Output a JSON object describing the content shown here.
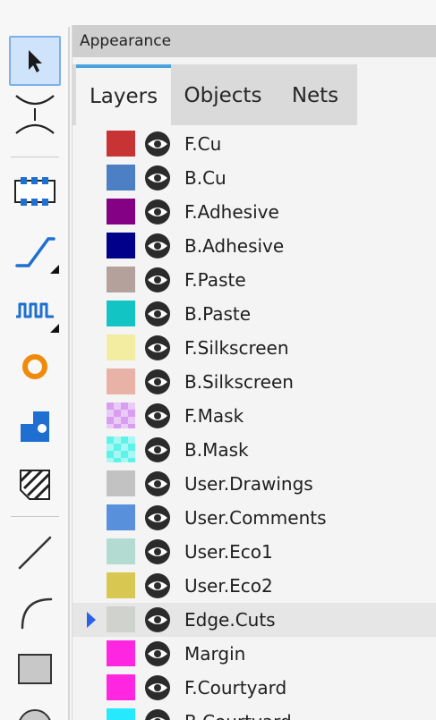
{
  "panel": {
    "title": "Appearance"
  },
  "tabs": [
    {
      "label": "Layers",
      "active": true
    },
    {
      "label": "Objects",
      "active": false
    },
    {
      "label": "Nets",
      "active": false
    }
  ],
  "toolbar": {
    "tools": [
      {
        "icon": "select-arrow-icon",
        "active": true
      },
      {
        "icon": "local-ratsnest-icon",
        "active": false
      },
      {
        "icon": "add-footprint-icon",
        "active": false
      },
      {
        "icon": "route-track-icon",
        "active": false
      },
      {
        "icon": "tune-length-icon",
        "active": false
      },
      {
        "icon": "add-via-icon",
        "active": false
      },
      {
        "icon": "add-pad-icon",
        "active": false
      },
      {
        "icon": "add-zone-icon",
        "active": false
      },
      {
        "icon": "draw-line-icon",
        "active": false
      },
      {
        "icon": "draw-arc-icon",
        "active": false
      },
      {
        "icon": "draw-rectangle-icon",
        "active": false
      },
      {
        "icon": "draw-circle-icon",
        "active": false
      }
    ]
  },
  "layers": [
    {
      "name": "F.Cu",
      "color": "#c83434",
      "pattern": "solid",
      "selected": false
    },
    {
      "name": "B.Cu",
      "color": "#4d7fc4",
      "pattern": "solid",
      "selected": false
    },
    {
      "name": "F.Adhesive",
      "color": "#840084",
      "pattern": "solid",
      "selected": false
    },
    {
      "name": "B.Adhesive",
      "color": "#00008a",
      "pattern": "solid",
      "selected": false
    },
    {
      "name": "F.Paste",
      "color": "#b4a19b",
      "pattern": "solid",
      "selected": false
    },
    {
      "name": "B.Paste",
      "color": "#13c4c4",
      "pattern": "solid",
      "selected": false
    },
    {
      "name": "F.Silkscreen",
      "color": "#f2eda1",
      "pattern": "solid",
      "selected": false
    },
    {
      "name": "B.Silkscreen",
      "color": "#e8b2a7",
      "pattern": "solid",
      "selected": false
    },
    {
      "name": "F.Mask",
      "color": "#d89ef0",
      "pattern": "checker",
      "selected": false
    },
    {
      "name": "B.Mask",
      "color": "#5ef3e8",
      "pattern": "checker",
      "selected": false
    },
    {
      "name": "User.Drawings",
      "color": "#c2c2c2",
      "pattern": "solid",
      "selected": false
    },
    {
      "name": "User.Comments",
      "color": "#5990dc",
      "pattern": "solid",
      "selected": false
    },
    {
      "name": "User.Eco1",
      "color": "#b4dbd2",
      "pattern": "solid",
      "selected": false
    },
    {
      "name": "User.Eco2",
      "color": "#d8c852",
      "pattern": "solid",
      "selected": false
    },
    {
      "name": "Edge.Cuts",
      "color": "#d0d2cd",
      "pattern": "solid",
      "selected": true
    },
    {
      "name": "Margin",
      "color": "#ff26e2",
      "pattern": "solid",
      "selected": false
    },
    {
      "name": "F.Courtyard",
      "color": "#ff26e2",
      "pattern": "solid",
      "selected": false
    },
    {
      "name": "B.Courtyard",
      "color": "#26e9ff",
      "pattern": "solid",
      "selected": false
    }
  ],
  "colors": {
    "active_tool_bg": "#cfe4fb",
    "active_tab_accent": "#4aa3df",
    "selection_arrow": "#2962e8"
  }
}
